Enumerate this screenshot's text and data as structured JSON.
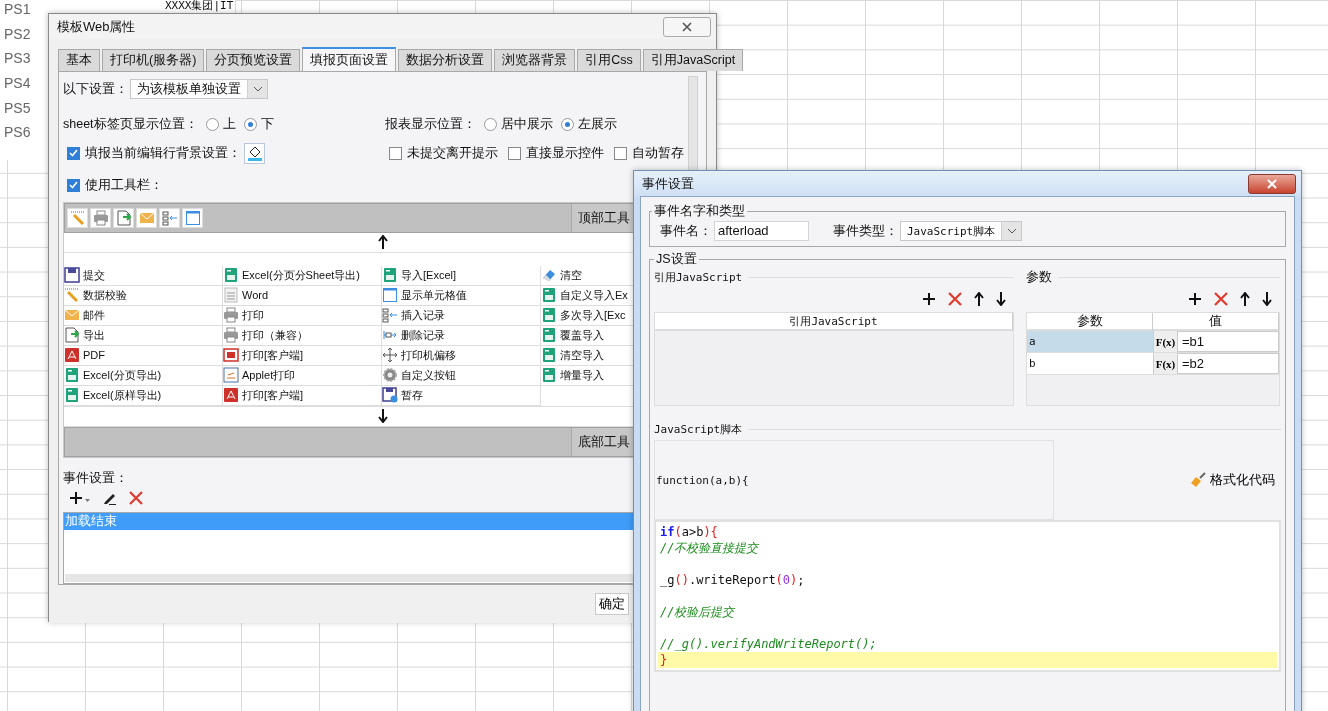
{
  "sheet": {
    "row_labels": [
      "PS1",
      "PS2",
      "PS3",
      "PS4",
      "PS5",
      "PS6"
    ],
    "top_cell": "XXXX集团|IT"
  },
  "properties_dialog": {
    "title": "模板Web属性",
    "tabs": [
      {
        "label": "基本",
        "selected": false
      },
      {
        "label": "打印机(服务器)",
        "selected": false
      },
      {
        "label": "分页预览设置",
        "selected": false
      },
      {
        "label": "填报页面设置",
        "selected": true
      },
      {
        "label": "数据分析设置",
        "selected": false
      },
      {
        "label": "浏览器背景",
        "selected": false
      },
      {
        "label": "引用Css",
        "selected": false
      },
      {
        "label": "引用JavaScript",
        "selected": false
      }
    ],
    "scope": {
      "label": "以下设置：",
      "value": "为该模板单独设置"
    },
    "sheet_tab_position": {
      "label": "sheet标签页显示位置：",
      "options": [
        {
          "label": "上",
          "selected": false
        },
        {
          "label": "下",
          "selected": true
        }
      ]
    },
    "report_position": {
      "label": "报表显示位置：",
      "options": [
        {
          "label": "居中展示",
          "selected": false
        },
        {
          "label": "左展示",
          "selected": true
        }
      ]
    },
    "row_background": {
      "label": "填报当前编辑行背景设置：",
      "checked": true
    },
    "options": [
      {
        "label": "未提交离开提示",
        "checked": false
      },
      {
        "label": "直接显示控件",
        "checked": false
      },
      {
        "label": "自动暂存",
        "checked": false
      }
    ],
    "use_toolbar": {
      "label": "使用工具栏：",
      "checked": true
    },
    "top_toolbar_label": "顶部工具",
    "bottom_toolbar_label": "底部工具",
    "toolbar_buttons": [
      {
        "label": "提交",
        "kind": "save"
      },
      {
        "label": "Excel(分页分Sheet导出)",
        "kind": "excel"
      },
      {
        "label": "导入[Excel]",
        "kind": "excel"
      },
      {
        "label": "清空",
        "kind": "eraser"
      },
      {
        "label": "数据校验",
        "kind": "check"
      },
      {
        "label": "Word",
        "kind": "word"
      },
      {
        "label": "显示单元格值",
        "kind": "cell"
      },
      {
        "label": "自定义导入Ex",
        "kind": "excel"
      },
      {
        "label": "邮件",
        "kind": "mail"
      },
      {
        "label": "打印",
        "kind": "print"
      },
      {
        "label": "插入记录",
        "kind": "insert"
      },
      {
        "label": "多次导入[Exc",
        "kind": "excel"
      },
      {
        "label": "导出",
        "kind": "export"
      },
      {
        "label": "打印（兼容）",
        "kind": "print"
      },
      {
        "label": "删除记录",
        "kind": "remove"
      },
      {
        "label": "覆盖导入",
        "kind": "excel"
      },
      {
        "label": "PDF",
        "kind": "pdf"
      },
      {
        "label": "打印[客户端]",
        "kind": "flash"
      },
      {
        "label": "打印机偏移",
        "kind": "move"
      },
      {
        "label": "清空导入",
        "kind": "excel"
      },
      {
        "label": "Excel(分页导出)",
        "kind": "excel"
      },
      {
        "label": "Applet打印",
        "kind": "applet"
      },
      {
        "label": "自定义按钮",
        "kind": "gear"
      },
      {
        "label": "增量导入",
        "kind": "excel"
      },
      {
        "label": "Excel(原样导出)",
        "kind": "excel"
      },
      {
        "label": "打印[客户端]",
        "kind": "pdf"
      },
      {
        "label": "暂存",
        "kind": "store"
      }
    ],
    "events_label": "事件设置：",
    "events": [
      {
        "label": "加载结束",
        "selected": true
      }
    ],
    "ok_button": "确定"
  },
  "event_dialog": {
    "title": "事件设置",
    "name_type_legend": "事件名字和类型",
    "name_label": "事件名：",
    "name_value": "afterload",
    "type_label": "事件类型：",
    "type_value": "JavaScript脚本",
    "js_legend": "JS设置",
    "ref_section": "引用JavaScript",
    "ref_column": "引用JavaScript",
    "params_section": "参数",
    "params_columns": [
      "参数",
      "值"
    ],
    "params": [
      {
        "name": "a",
        "formula": "F(x)",
        "value": "=b1",
        "selected": true
      },
      {
        "name": "b",
        "formula": "F(x)",
        "value": "=b2",
        "selected": false
      }
    ],
    "script_section": "JavaScript脚本",
    "function_header": "function(a,b){",
    "format_button": "格式化代码",
    "code_lines": [
      {
        "tokens": [
          {
            "text": "if",
            "kind": "keyword"
          },
          {
            "text": "(",
            "kind": "paren"
          },
          {
            "text": "a>b",
            "kind": "plain"
          },
          {
            "text": "){",
            "kind": "paren"
          }
        ],
        "gap_before": false,
        "highlighted": false
      },
      {
        "tokens": [
          {
            "text": "//不校验直接提交",
            "kind": "comment"
          }
        ],
        "gap_before": false,
        "highlighted": false
      },
      {
        "tokens": [
          {
            "text": "_g",
            "kind": "plain"
          },
          {
            "text": "()",
            "kind": "paren"
          },
          {
            "text": ".writeReport",
            "kind": "plain"
          },
          {
            "text": "(",
            "kind": "paren"
          },
          {
            "text": "0",
            "kind": "number"
          },
          {
            "text": ")",
            "kind": "paren"
          },
          {
            "text": ";",
            "kind": "plain"
          }
        ],
        "gap_before": true,
        "highlighted": false
      },
      {
        "tokens": [
          {
            "text": "//校验后提交",
            "kind": "comment"
          }
        ],
        "gap_before": true,
        "highlighted": false
      },
      {
        "tokens": [
          {
            "text": "//_g().verifyAndWriteReport();",
            "kind": "comment"
          }
        ],
        "gap_before": true,
        "highlighted": false
      },
      {
        "tokens": [
          {
            "text": "}",
            "kind": "paren"
          }
        ],
        "gap_before": false,
        "highlighted": true
      }
    ]
  }
}
